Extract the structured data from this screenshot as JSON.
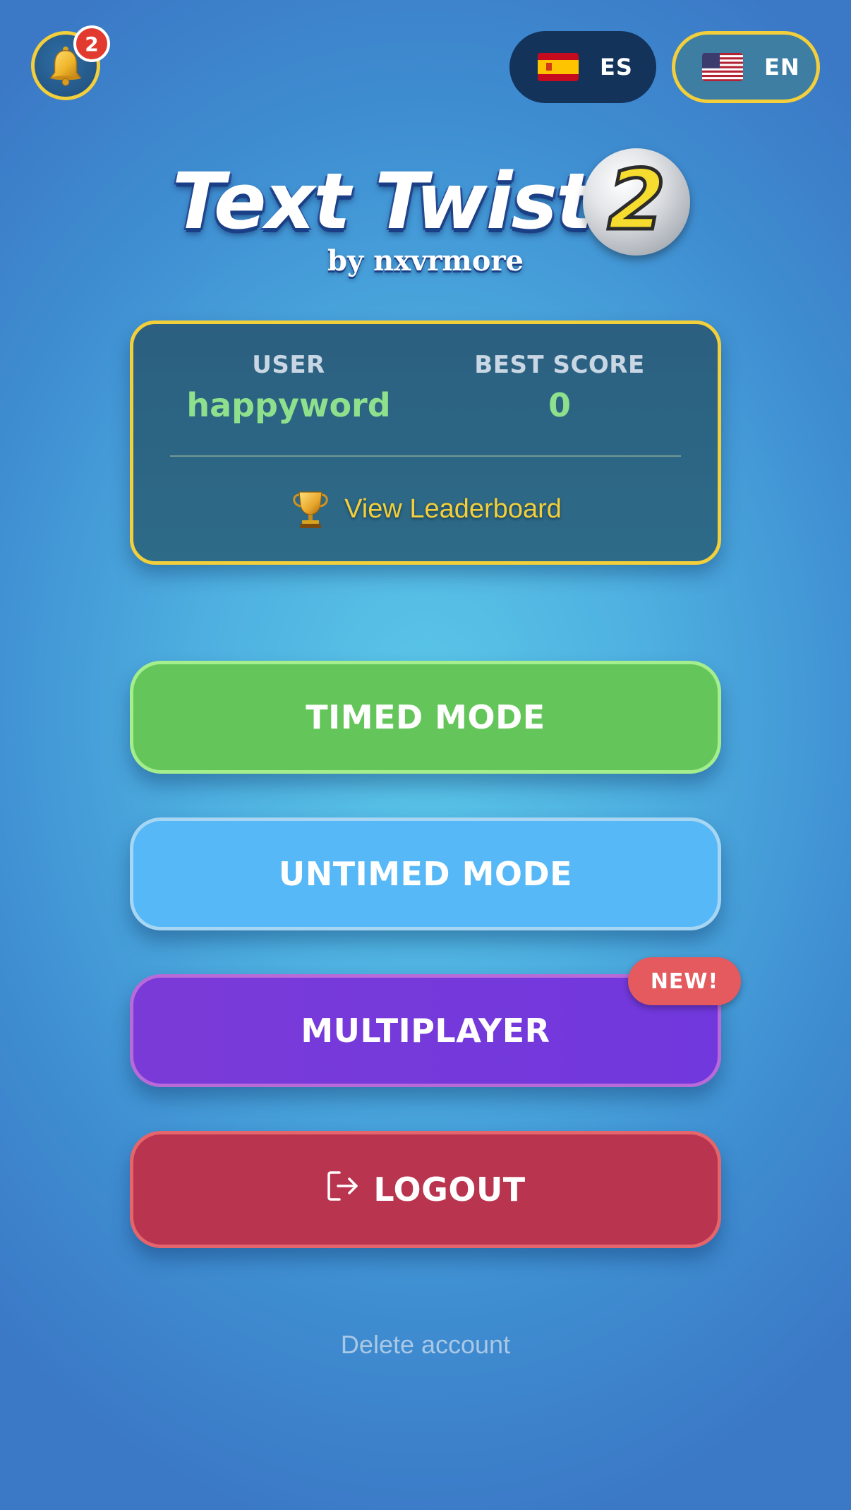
{
  "notifications": {
    "count": "2"
  },
  "languages": [
    {
      "code": "ES",
      "selected": false
    },
    {
      "code": "EN",
      "selected": true
    }
  ],
  "title": {
    "main": "Text Twist",
    "number": "2",
    "byline": "by nxvrmore"
  },
  "stats": {
    "user_label": "USER",
    "user_value": "happyword",
    "best_label": "BEST SCORE",
    "best_value": "0",
    "leaderboard_label": "View Leaderboard"
  },
  "modes": {
    "timed": "TIMED MODE",
    "untimed": "UNTIMED MODE",
    "multiplayer": "MULTIPLAYER",
    "multiplayer_badge": "NEW!",
    "logout": "LOGOUT"
  },
  "footer": {
    "delete_account": "Delete account"
  },
  "icons": {
    "notifications": "bell-icon",
    "leaderboard": "trophy-icon",
    "logout": "logout-icon",
    "es_flag": "spain-flag-icon",
    "en_flag": "us-flag-icon"
  },
  "colors": {
    "accent_gold": "#f2cf3b",
    "timed": "#64c65a",
    "untimed": "#56b8f6",
    "multiplayer": "#7a3ad8",
    "logout": "#b9344e",
    "badge": "#e45a5e",
    "stat_value": "#8ee08c"
  }
}
